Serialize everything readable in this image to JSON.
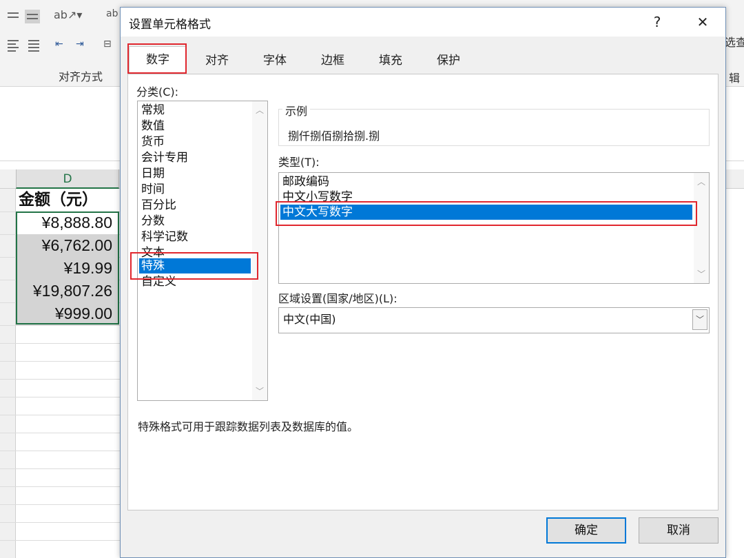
{
  "ribbon": {
    "group_label": "对齐方式",
    "right_frag_1": "选",
    "right_frag_2": "查",
    "right_frag_3": "辑"
  },
  "sheet": {
    "column_letter": "D",
    "header_cell": "金额（元）",
    "values": [
      "¥8,888.80",
      "¥6,762.00",
      "¥19.99",
      "¥19,807.26",
      "¥999.00"
    ]
  },
  "dialog": {
    "title": "设置单元格格式",
    "help_label": "?",
    "close_label": "✕",
    "tabs": [
      "数字",
      "对齐",
      "字体",
      "边框",
      "填充",
      "保护"
    ],
    "active_tab": "数字",
    "category_label": "分类(C):",
    "categories": [
      "常规",
      "数值",
      "货币",
      "会计专用",
      "日期",
      "时间",
      "百分比",
      "分数",
      "科学记数",
      "文本",
      "特殊",
      "自定义"
    ],
    "selected_category": "特殊",
    "sample_label": "示例",
    "sample_value": "捌仟捌佰捌拾捌.捌",
    "type_label": "类型(T):",
    "types": [
      "邮政编码",
      "中文小写数字",
      "中文大写数字"
    ],
    "selected_type": "中文大写数字",
    "locale_label": "区域设置(国家/地区)(L):",
    "locale_value": "中文(中国)",
    "description": "特殊格式可用于跟踪数据列表及数据库的值。",
    "ok_label": "确定",
    "cancel_label": "取消"
  },
  "colors": {
    "selection_blue": "#0078d7",
    "highlight_red": "#e0262d",
    "excel_green": "#217346"
  },
  "icons": [
    "align-left-icon",
    "align-center-icon",
    "orientation-icon",
    "wrap-text-icon",
    "decrease-indent-icon",
    "increase-indent-icon",
    "merge-icon",
    "scroll-up-icon",
    "scroll-down-icon",
    "dropdown-icon"
  ]
}
